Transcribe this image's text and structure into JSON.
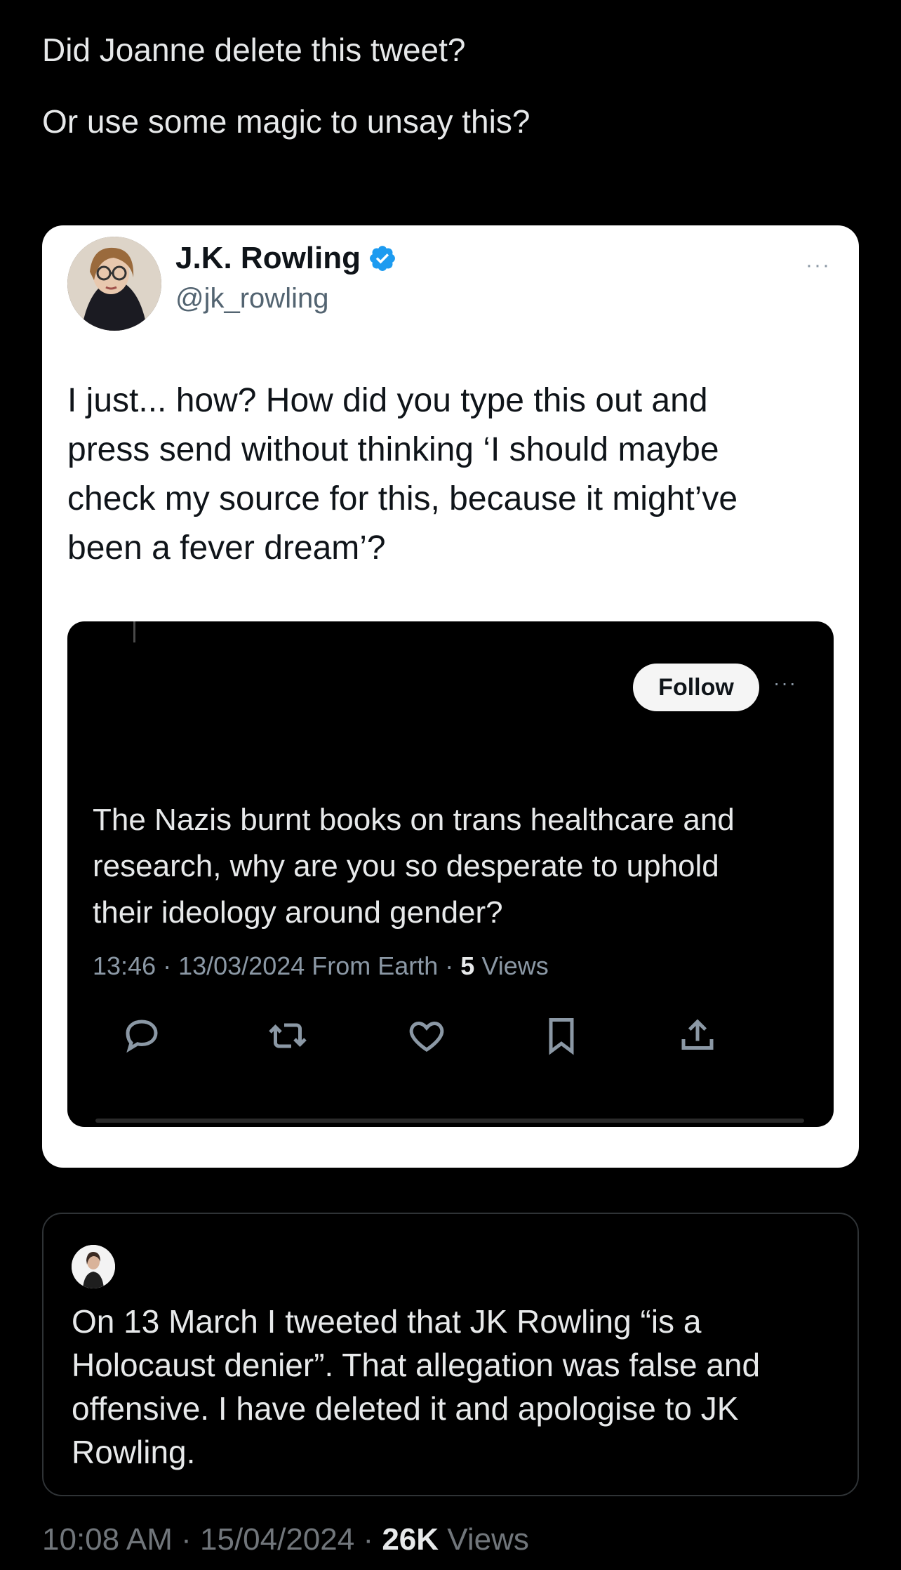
{
  "post": {
    "lines": [
      "Did Joanne delete this tweet?",
      "Or use some magic to unsay this?"
    ]
  },
  "quoted_card": {
    "name": "J.K. Rowling",
    "handle": "@jk_rowling",
    "more_icon": "···",
    "body_lines": [
      "I just... how? How did you type this out and",
      "press send without thinking ‘I should maybe",
      "check my source for this, because it might’ve",
      "been a fever dream’?"
    ],
    "accent_color": "#1d9bf0"
  },
  "embedded_tweet": {
    "follow_label": "Follow",
    "more_icon": "···",
    "body_lines": [
      "The Nazis burnt books on trans healthcare and",
      "research, why are you so desperate to uphold",
      "their ideology around gender?"
    ],
    "meta_prefix": "13:46 · 13/03/2024 From Earth · ",
    "views_count": "5",
    "views_label": " Views",
    "actions": [
      "reply-icon",
      "retweet-icon",
      "like-icon",
      "bookmark-icon",
      "share-icon"
    ]
  },
  "note": {
    "lines": [
      "On 13 March I tweeted that JK Rowling “is a",
      "Holocaust denier”. That allegation was false and",
      "offensive. I have deleted it and apologise to JK",
      "Rowling."
    ]
  },
  "footer": {
    "meta_prefix": "10:08 AM · 15/04/2024 · ",
    "views_count": "26K",
    "views_label": " Views"
  }
}
